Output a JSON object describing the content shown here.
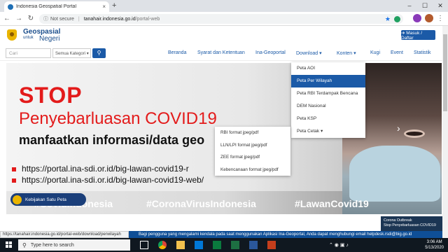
{
  "browser": {
    "tab_title": "Indonesia Geospatial Portal",
    "url_info": "ⓘ",
    "url_security": "Not secure",
    "url_host": "tanahair.indonesia.go.id",
    "url_path": "/portal-web"
  },
  "site": {
    "logo_title": "Geospasial",
    "logo_sub1": "untuk",
    "logo_sub2": "Negeri",
    "login_label": "➔ Masuk / Daftar"
  },
  "search": {
    "placeholder": "Cari",
    "category": "Semua Kategori ▾"
  },
  "nav": {
    "items": [
      "Beranda",
      "Syarat dan Ketentuan",
      "Ina-Geoportal",
      "Download ▾",
      "Konten ▾",
      "Kugi",
      "Event",
      "Statistik"
    ]
  },
  "download_menu": {
    "items": [
      "Peta AOI",
      "Peta Per Wilayah",
      "Peta RBI Terdampak Bencana",
      "DEM Nasional",
      "Peta KSP",
      "Peta Cetak ▾"
    ],
    "active_index": 1
  },
  "cetak_submenu": {
    "items": [
      "RBI format jpeg/pdf",
      "LLN/LPI format jpeg/pdf",
      "ZEE format jpeg/pdf",
      "Kebencanaan format jpeg/pdf"
    ]
  },
  "banner": {
    "stop": "STOP",
    "headline": "Penyebarluasan COVID19",
    "subline": "manfaatkan informasi/data geo",
    "link1": "https://portal.ina-sdi.or.id/big-lawan-covid19-r",
    "link2": "https://portal.ina-sdi.or.id/big-lawan-covid19-web/",
    "hashtag1": "#CovidIndonesia",
    "hashtag2": "#CoronaVirusIndonesia",
    "hashtag3": "#LawanCovid19",
    "badge": "Kebijakan Satu Peta"
  },
  "status": {
    "hover_url": "https://tanahair.indonesia.go.id/portal-web/download/perwilayah",
    "ticker": "Bagi pengguna yang mengalami kendala pada saat menggunakan Aplikasi Ina-Geoportal, Anda dapat menghubungi email helpdesk.rsdi@big.go.id",
    "notif_line1": "Corona Outbreak",
    "notif_line2": "Stop Penyebarluasan COVID19"
  },
  "taskbar": {
    "search_placeholder": "Type here to search",
    "time": "3:06 AM",
    "date": "5/13/2020"
  },
  "colors": {
    "brand_blue": "#1b5aa7",
    "banner_red": "#e31b1b"
  }
}
